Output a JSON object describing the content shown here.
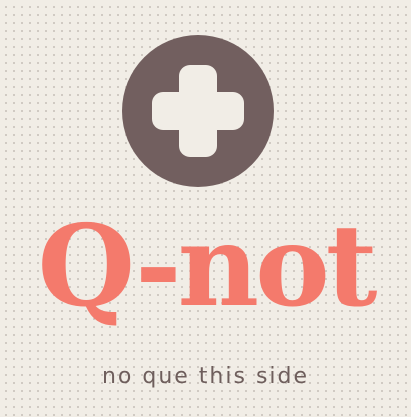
{
  "logo": {
    "icon": "plus-icon",
    "brand_name": "Q-not",
    "tagline": "no que this side"
  },
  "colors": {
    "background": "#f1ede6",
    "badge": "#725f5f",
    "brand_text": "#f47a6c",
    "tagline_text": "#6e5e5c"
  }
}
